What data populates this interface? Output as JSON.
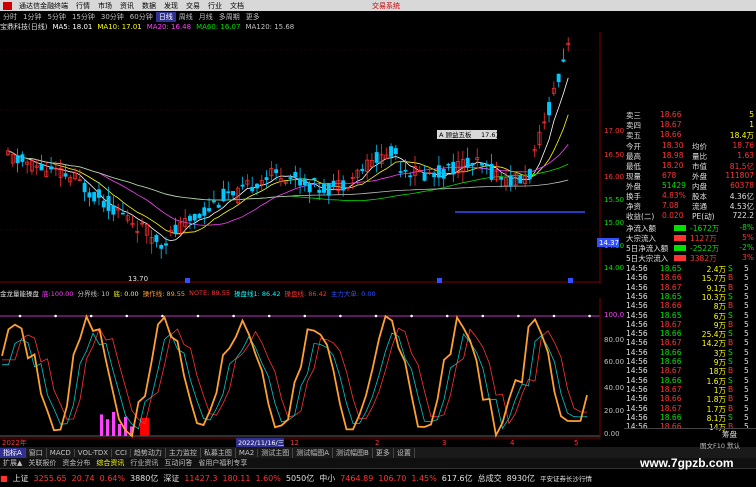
{
  "window": {
    "app_title": "通达信金融终端",
    "brand": "交易系统"
  },
  "menu": [
    "行情",
    "市场",
    "资讯",
    "数据",
    "发现",
    "交易",
    "行业",
    "文档"
  ],
  "toolbar": [
    "分时",
    "1分钟",
    "5分钟",
    "15分钟",
    "30分钟",
    "60分钟",
    "日线",
    "周线",
    "月线",
    "多周期",
    "更多"
  ],
  "toolbar_active": "日线",
  "ma_legend": {
    "stock": "宝鼎科技(日线)",
    "items": [
      {
        "label": "MA5: 18.01",
        "color": "#ffffff"
      },
      {
        "label": "MA10: 17.01",
        "color": "#ffff00"
      },
      {
        "label": "MA20: 16.48",
        "color": "#ff40ff"
      },
      {
        "label": "MA60: 16.07",
        "color": "#00e000"
      },
      {
        "label": "MA120: 15.68",
        "color": "#c0c0c0"
      }
    ]
  },
  "price_axis": [
    "17.00",
    "16.50",
    "16.00",
    "15.50",
    "15.00",
    "14.50",
    "14.00"
  ],
  "price_current_tag": "14.37",
  "price_low_label": "13.70",
  "popup_label": "A 顾益五板",
  "popup_value": "17.6万",
  "indicator_legend": {
    "name": "金龙量能操盘",
    "items": [
      {
        "label": "底:100.00",
        "color": "#ff40ff"
      },
      {
        "label": "分界线: 10",
        "color": "#c0c0c0"
      },
      {
        "label": "底: 0.00",
        "color": "#ffff00"
      },
      {
        "label": "操作线: 89.55",
        "color": "#ffa030"
      },
      {
        "label": "NOTE: 89.55",
        "color": "#ff3232"
      },
      {
        "label": "操盘线1: 86.42",
        "color": "#00ffff"
      },
      {
        "label": "操盘线: 86.42",
        "color": "#ff3232"
      },
      {
        "label": "主力大单: 0.00",
        "color": "#3050ff"
      }
    ]
  },
  "indicator_axis": [
    "100.00",
    "80.00",
    "60.00",
    "40.00",
    "20.00",
    "0.00"
  ],
  "date_axis": {
    "left": "2022年",
    "highlight": "2022/11/16/三",
    "marks": [
      "12",
      "2",
      "3",
      "4",
      "5"
    ]
  },
  "quote_panel": {
    "asks": [
      {
        "label": "卖三",
        "price": "18.66",
        "vol": "5"
      },
      {
        "label": "卖四",
        "price": "18.67",
        "vol": "1"
      },
      {
        "label": "卖五",
        "price": "18.66",
        "vol": "18.4万"
      }
    ],
    "stats": [
      {
        "l1": "今开",
        "v1": "18.30",
        "l2": "均价",
        "v2": "18.76"
      },
      {
        "l1": "最高",
        "v1": "18.98",
        "l2": "量比",
        "v2": "1.63"
      },
      {
        "l1": "最低",
        "v1": "18.20",
        "l2": "市值",
        "v2": "81.5亿"
      },
      {
        "l1": "现量",
        "v1": "678",
        "l2": "外盘",
        "v2": "111807"
      },
      {
        "l1": "外盘",
        "v1": "51429",
        "l2": "内盘",
        "v2": "60378"
      },
      {
        "l1": "换手",
        "v1": "4.83%",
        "l2": "股本",
        "v2": "4.36亿"
      },
      {
        "l1": "净资",
        "v1": "7.08",
        "l2": "流通",
        "v2": "4.53亿"
      },
      {
        "l1": "收益(二)",
        "v1": "0.020",
        "l2": "PE(动)",
        "v2": "722.2"
      }
    ],
    "flows": [
      {
        "label": "净流入额",
        "value": "-1672万",
        "pct": "-8%"
      },
      {
        "label": "大宗流入",
        "value": "1127万",
        "pct": "5%"
      },
      {
        "label": "5日净流入额",
        "value": "-2522万",
        "pct": "-2%"
      },
      {
        "label": "5日大宗流入",
        "value": "3382万",
        "pct": "3%"
      }
    ],
    "ticks": [
      {
        "time": "14:56",
        "price": "18.65",
        "vol": "2.4万",
        "side": "S",
        "n": "5"
      },
      {
        "time": "14:56",
        "price": "18.66",
        "vol": "15.7万",
        "side": "B",
        "n": "5"
      },
      {
        "time": "14:56",
        "price": "18.67",
        "vol": "9.1万",
        "side": "B",
        "n": "5"
      },
      {
        "time": "14:56",
        "price": "18.65",
        "vol": "10.3万",
        "side": "S",
        "n": "5"
      },
      {
        "time": "14:56",
        "price": "18.66",
        "vol": "8万",
        "side": "B",
        "n": "5"
      },
      {
        "time": "14:56",
        "price": "18.65",
        "vol": "6万",
        "side": "S",
        "n": "5"
      },
      {
        "time": "14:56",
        "price": "18.67",
        "vol": "9万",
        "side": "B",
        "n": "5"
      },
      {
        "time": "14:56",
        "price": "18.66",
        "vol": "25.4万",
        "side": "S",
        "n": "5"
      },
      {
        "time": "14:56",
        "price": "18.67",
        "vol": "14.2万",
        "side": "B",
        "n": "5"
      },
      {
        "time": "14:56",
        "price": "18.66",
        "vol": "3万",
        "side": "S",
        "n": "5"
      },
      {
        "time": "14:56",
        "price": "18.66",
        "vol": "9万",
        "side": "S",
        "n": "5"
      },
      {
        "time": "14:56",
        "price": "18.67",
        "vol": "18万",
        "side": "B",
        "n": "5"
      },
      {
        "time": "14:56",
        "price": "18.66",
        "vol": "1.6万",
        "side": "S",
        "n": "5"
      },
      {
        "time": "14:56",
        "price": "18.67",
        "vol": "1万",
        "side": "B",
        "n": "5"
      },
      {
        "time": "14:56",
        "price": "18.66",
        "vol": "1.8万",
        "side": "B",
        "n": "5"
      },
      {
        "time": "14:56",
        "price": "18.67",
        "vol": "1.7万",
        "side": "B",
        "n": "5"
      },
      {
        "time": "14:56",
        "price": "18.66",
        "vol": "8.1万",
        "side": "S",
        "n": "5"
      },
      {
        "time": "14:56",
        "price": "18.66",
        "vol": "14万",
        "side": "B",
        "n": "5"
      },
      {
        "time": "14:56",
        "price": "18.67",
        "vol": "1.4万",
        "side": "B",
        "n": "5"
      },
      {
        "time": "14:56",
        "price": "18.67",
        "vol": "1.1万",
        "side": "S",
        "n": "5"
      }
    ],
    "bottom_tab": "筹盘"
  },
  "indicator_tabs": [
    "指标A",
    "窗口",
    "MACD",
    "VOL-TDX",
    "CCI",
    "趋势动力",
    "主力监控",
    "私募主图",
    "MA2",
    "测试主图",
    "测试幅图A",
    "测试幅图B",
    "更多",
    "设置"
  ],
  "indicator_tab_active": "指标A",
  "sub_tabs": [
    "扩展▲",
    "关联报价",
    "资金分布",
    "综合资讯",
    "行业资讯",
    "互动问答",
    "省用户福利专享"
  ],
  "sub_tab_active": "综合资讯",
  "status": [
    {
      "name": "上证",
      "value": "3255.65",
      "chg": "20.74",
      "pct": "0.64%",
      "amt": "3880亿"
    },
    {
      "name": "深证",
      "value": "11427.3",
      "chg": "180.11",
      "pct": "1.60%",
      "amt": "5050亿"
    },
    {
      "name": "中小",
      "value": "7464.89",
      "chg": "106.70",
      "pct": "1.45%",
      "amt": "617.6亿"
    }
  ],
  "status_extra": {
    "total_label": "总成交",
    "total_value": "8930亿",
    "server": "平安证券长沙行情"
  },
  "watermark": "www.7gpzb.com",
  "footer_note": "图文F10 默认"
}
